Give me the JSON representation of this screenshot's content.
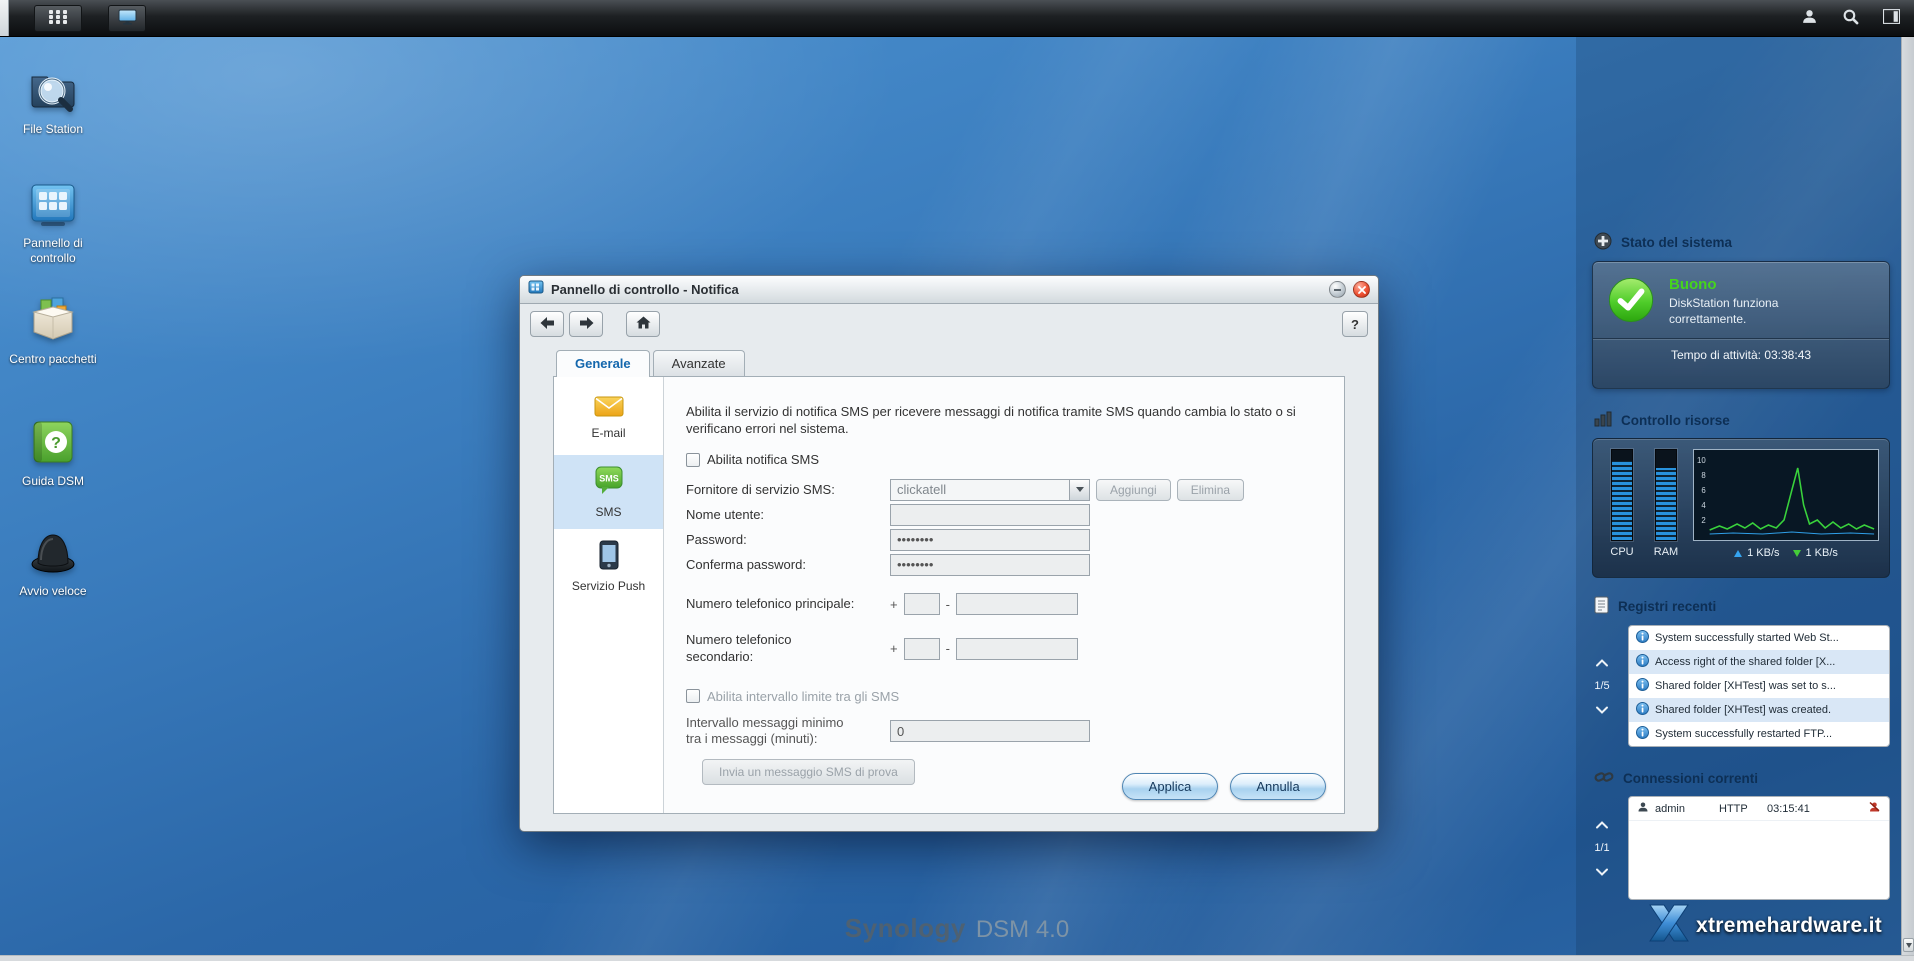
{
  "desktop": {
    "icons": [
      {
        "label": "File Station"
      },
      {
        "label": "Pannello di controllo"
      },
      {
        "label": "Centro pacchetti"
      },
      {
        "label": "Guida DSM"
      },
      {
        "label": "Avvio veloce"
      }
    ],
    "brand_name": "Synology",
    "brand_version": "DSM 4.0"
  },
  "window": {
    "title": "Pannello di controllo - Notifica",
    "help_label": "?",
    "tabs": [
      {
        "label": "Generale"
      },
      {
        "label": "Avanzate"
      }
    ],
    "nav": [
      {
        "label": "E-mail"
      },
      {
        "label": "SMS"
      },
      {
        "label": "Servizio Push"
      }
    ],
    "form": {
      "description": "Abilita il servizio di notifica SMS per ricevere messaggi di notifica tramite SMS quando cambia lo stato o si verificano errori nel sistema.",
      "enable_sms": "Abilita notifica SMS",
      "provider_label": "Fornitore di servizio SMS:",
      "provider_value": "clickatell",
      "add_button": "Aggiungi",
      "delete_button": "Elimina",
      "username_label": "Nome utente:",
      "password_label": "Password:",
      "password_value": "••••••••",
      "confirm_label": "Conferma password:",
      "confirm_value": "••••••••",
      "phone1_label": "Numero telefonico principale:",
      "phone2_label": "Numero telefonico secondario:",
      "plus": "+",
      "dash": "-",
      "interval_enable": "Abilita intervallo limite tra gli SMS",
      "interval_label": "Intervallo messaggi minimo tra i messaggi (minuti):",
      "interval_value": "0",
      "test_button": "Invia un messaggio SMS di prova",
      "apply": "Applica",
      "cancel": "Annulla"
    }
  },
  "widgets": {
    "system_status": {
      "title": "Stato del sistema",
      "state": "Buono",
      "detail": "DiskStation funziona correttamente.",
      "uptime": "Tempo di attività: 03:38:43"
    },
    "resources": {
      "title": "Controllo risorse",
      "cpu": "CPU",
      "ram": "RAM",
      "axis": [
        "10",
        "8",
        "6",
        "4",
        "2"
      ],
      "upload": "1 KB/s",
      "download": "1 KB/s"
    },
    "logs": {
      "title": "Registri recenti",
      "page": "1/5",
      "entries": [
        "System successfully started Web St...",
        "Access right of the shared folder [X...",
        "Shared folder [XHTest] was set to s...",
        "Shared folder [XHTest] was created.",
        "System successfully restarted FTP..."
      ]
    },
    "connections": {
      "title": "Connessioni correnti",
      "page": "1/1",
      "rows": [
        {
          "user": "admin",
          "protocol": "HTTP",
          "time": "03:15:41"
        }
      ]
    }
  },
  "watermark": {
    "text": "xtremehardware.it"
  },
  "icon_names": [
    "main-menu-icon",
    "show-desktop-icon",
    "user-icon",
    "search-icon",
    "widgets-panel-icon",
    "file-station-icon",
    "control-panel-icon",
    "package-center-icon",
    "dsm-help-icon",
    "quick-launch-icon",
    "email-icon",
    "sms-icon",
    "push-service-icon",
    "back-icon",
    "forward-icon",
    "home-icon",
    "minimize-icon",
    "close-icon",
    "select-arrow-icon",
    "shield-plus-icon",
    "resource-bars-icon",
    "logs-icon",
    "connections-icon",
    "info-icon",
    "check-icon",
    "user-small-icon",
    "disconnect-icon",
    "chevron-up-icon",
    "chevron-down-icon",
    "upload-arrow-icon",
    "download-arrow-icon",
    "scroll-down-icon"
  ]
}
